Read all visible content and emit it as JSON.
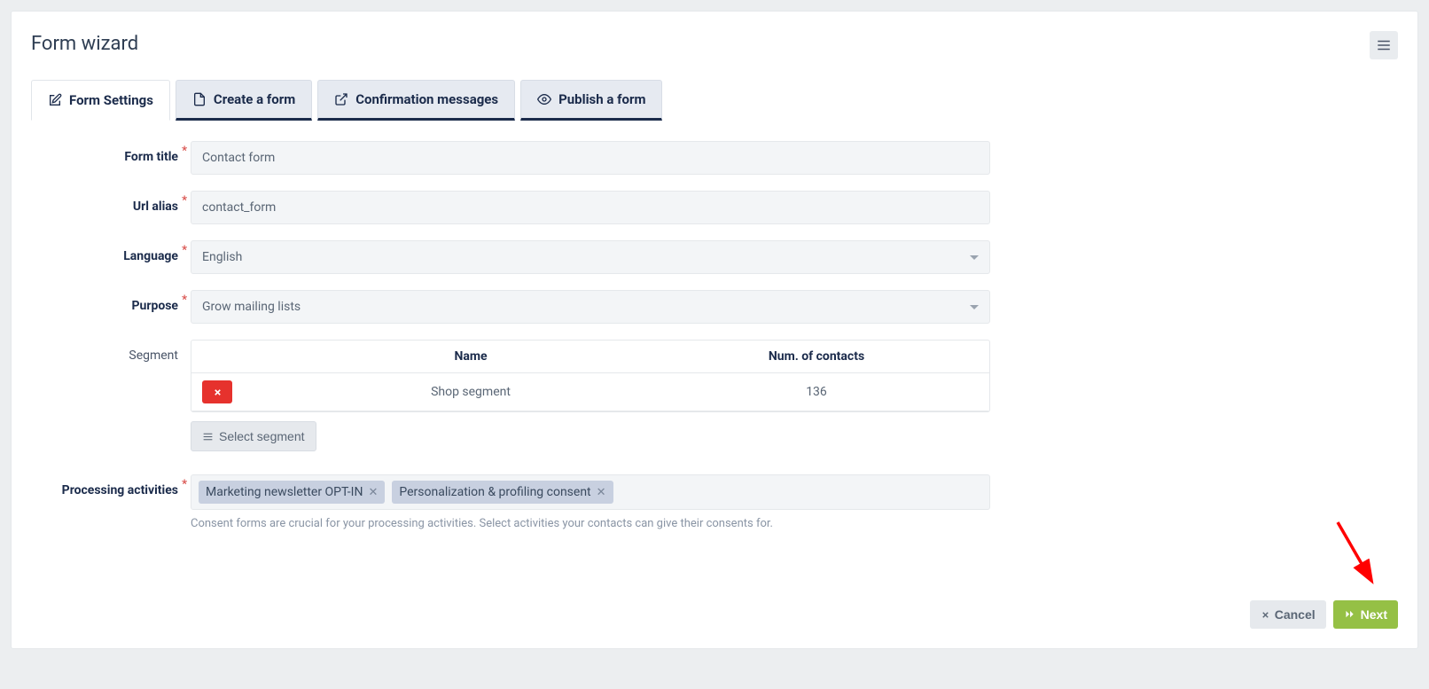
{
  "header": {
    "title": "Form wizard"
  },
  "tabs": [
    {
      "label": "Form Settings"
    },
    {
      "label": "Create a form"
    },
    {
      "label": "Confirmation messages"
    },
    {
      "label": "Publish a form"
    }
  ],
  "fields": {
    "form_title": {
      "label": "Form title",
      "value": "Contact form"
    },
    "url_alias": {
      "label": "Url alias",
      "value": "contact_form"
    },
    "language": {
      "label": "Language",
      "value": "English"
    },
    "purpose": {
      "label": "Purpose",
      "value": "Grow mailing lists"
    },
    "segment": {
      "label": "Segment",
      "columns": {
        "name": "Name",
        "contacts": "Num. of contacts"
      },
      "rows": [
        {
          "name": "Shop segment",
          "contacts": "136"
        }
      ],
      "select_button": "Select segment"
    },
    "processing": {
      "label": "Processing activities",
      "tags": [
        "Marketing newsletter OPT-IN",
        "Personalization & profiling consent"
      ],
      "help": "Consent forms are crucial for your processing activities. Select activities your contacts can give their consents for."
    }
  },
  "footer": {
    "cancel": "Cancel",
    "next": "Next"
  }
}
